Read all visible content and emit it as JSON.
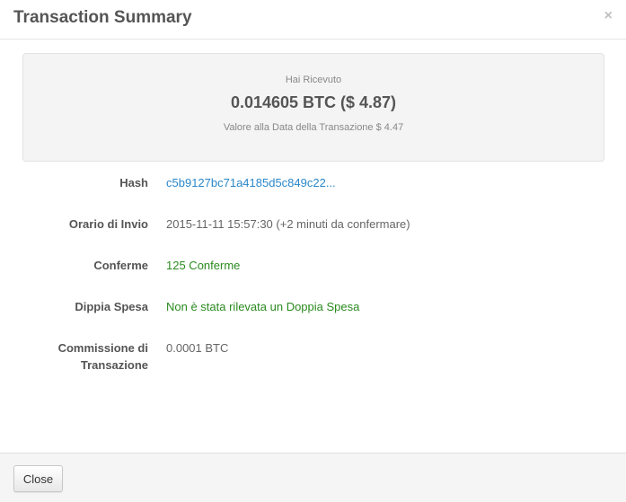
{
  "header": {
    "title": "Transaction Summary",
    "close_icon": "×"
  },
  "summary": {
    "label": "Hai Ricevuto",
    "amount": "0.014605 BTC ($ 4.87)",
    "value_at_date": "Valore alla Data della Transazione $ 4.47"
  },
  "details": [
    {
      "label": "Hash",
      "value": "c5b9127bc71a4185d5c849c22..."
    },
    {
      "label": "Orario di Invio",
      "value": "2015-11-11 15:57:30 (+2 minuti da confermare)"
    },
    {
      "label": "Conferme",
      "value": "125 Conferme"
    },
    {
      "label": "Dippia Spesa",
      "value": "Non è stata rilevata un Doppia Spesa"
    },
    {
      "label_line1": "Commissione di",
      "label_line2": "Transazione",
      "value": "0.0001 BTC"
    }
  ],
  "footer": {
    "close_label": "Close"
  },
  "colors": {
    "link": "#2a87c9",
    "success": "#2a8a1f"
  }
}
